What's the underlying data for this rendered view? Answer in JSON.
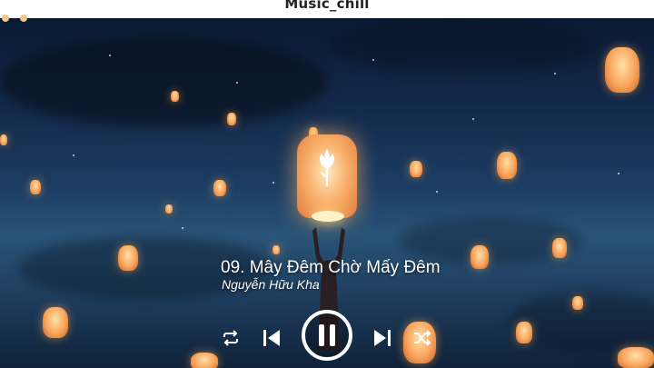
{
  "window": {
    "title": "Music_chill"
  },
  "player": {
    "track_title": "09. Mây Đêm Chờ Mấy Đêm",
    "artist": "Nguyễn Hữu Kha",
    "state": "playing"
  },
  "controls": {
    "repeat_icon": "repeat-icon",
    "previous_icon": "skip-previous-icon",
    "play_pause_icon": "pause-icon",
    "next_icon": "skip-next-icon",
    "shuffle_icon": "shuffle-icon"
  },
  "colors": {
    "sky_top": "#0a1a33",
    "sky_mid": "#295478",
    "lantern": "#f8a45a",
    "text": "#ffffff"
  }
}
